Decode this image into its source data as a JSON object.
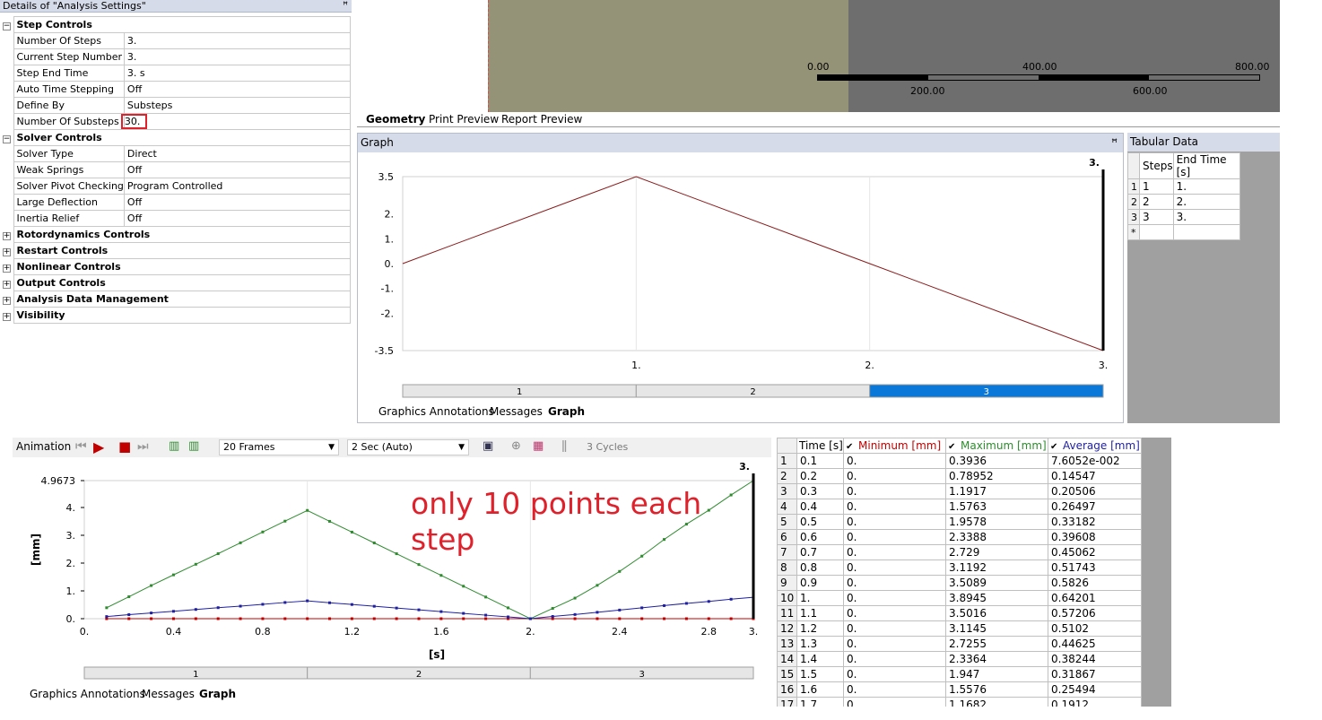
{
  "details": {
    "title": "Details of \"Analysis Settings\"",
    "pin": "ꟸ",
    "rows": [
      {
        "type": "group",
        "label": "Step Controls",
        "expander": "−"
      },
      {
        "type": "prop",
        "name": "Number Of Steps",
        "value": "3."
      },
      {
        "type": "prop",
        "name": "Current Step Number",
        "value": "3."
      },
      {
        "type": "prop",
        "name": "Step End Time",
        "value": "3. s"
      },
      {
        "type": "prop",
        "name": "Auto Time Stepping",
        "value": "Off"
      },
      {
        "type": "prop",
        "name": "Define By",
        "value": "Substeps"
      },
      {
        "type": "prop",
        "name": "Number Of Substeps",
        "value": "30.",
        "highlight": true
      },
      {
        "type": "group",
        "label": "Solver Controls",
        "expander": "−"
      },
      {
        "type": "prop",
        "name": "Solver Type",
        "value": "Direct"
      },
      {
        "type": "prop",
        "name": "Weak Springs",
        "value": "Off"
      },
      {
        "type": "prop",
        "name": "Solver Pivot Checking",
        "value": "Program Controlled"
      },
      {
        "type": "prop",
        "name": "Large Deflection",
        "value": "Off"
      },
      {
        "type": "prop",
        "name": "Inertia Relief",
        "value": "Off"
      },
      {
        "type": "group",
        "label": "Rotordynamics Controls",
        "expander": "+"
      },
      {
        "type": "group",
        "label": "Restart Controls",
        "expander": "+"
      },
      {
        "type": "group",
        "label": "Nonlinear Controls",
        "expander": "+"
      },
      {
        "type": "group",
        "label": "Output Controls",
        "expander": "+"
      },
      {
        "type": "group",
        "label": "Analysis Data Management",
        "expander": "+"
      },
      {
        "type": "group",
        "label": "Visibility",
        "expander": "+"
      }
    ]
  },
  "geometry": {
    "scale_top": [
      "0.00",
      "400.00",
      "800.00"
    ],
    "scale_bottom": [
      "200.00",
      "600.00"
    ],
    "tabs": [
      "Geometry",
      "Print Preview",
      "Report Preview"
    ]
  },
  "graph_panel": {
    "title": "Graph",
    "pin": "ꟸ",
    "tabs": [
      "Graphics Annotations",
      "Messages",
      "Graph"
    ]
  },
  "tabular": {
    "title": "Tabular Data",
    "headers": [
      "Steps",
      "End Time [s]"
    ],
    "rows": [
      [
        "1",
        "1",
        "1."
      ],
      [
        "2",
        "2",
        "2."
      ],
      [
        "3",
        "3",
        "3."
      ],
      [
        "*",
        "",
        ""
      ]
    ]
  },
  "animation": {
    "label": "Animation",
    "frames": "20 Frames",
    "duration": "2 Sec (Auto)",
    "cycles": "3 Cycles"
  },
  "annotation": "only 10 points each step",
  "bottom_tabs": [
    "Graphics Annotations",
    "Messages",
    "Graph"
  ],
  "data_table": {
    "headers": [
      "Time [s]",
      "Minimum [mm]",
      "Maximum [mm]",
      "Average [mm]"
    ],
    "header_colors": [
      "#000000",
      "#c00000",
      "#2e8b2e",
      "#1f1fa0"
    ],
    "rows": [
      [
        "1",
        "0.1",
        "0.",
        "0.3936",
        "7.6052e-002"
      ],
      [
        "2",
        "0.2",
        "0.",
        "0.78952",
        "0.14547"
      ],
      [
        "3",
        "0.3",
        "0.",
        "1.1917",
        "0.20506"
      ],
      [
        "4",
        "0.4",
        "0.",
        "1.5763",
        "0.26497"
      ],
      [
        "5",
        "0.5",
        "0.",
        "1.9578",
        "0.33182"
      ],
      [
        "6",
        "0.6",
        "0.",
        "2.3388",
        "0.39608"
      ],
      [
        "7",
        "0.7",
        "0.",
        "2.729",
        "0.45062"
      ],
      [
        "8",
        "0.8",
        "0.",
        "3.1192",
        "0.51743"
      ],
      [
        "9",
        "0.9",
        "0.",
        "3.5089",
        "0.5826"
      ],
      [
        "10",
        "1.",
        "0.",
        "3.8945",
        "0.64201"
      ],
      [
        "11",
        "1.1",
        "0.",
        "3.5016",
        "0.57206"
      ],
      [
        "12",
        "1.2",
        "0.",
        "3.1145",
        "0.5102"
      ],
      [
        "13",
        "1.3",
        "0.",
        "2.7255",
        "0.44625"
      ],
      [
        "14",
        "1.4",
        "0.",
        "2.3364",
        "0.38244"
      ],
      [
        "15",
        "1.5",
        "0.",
        "1.947",
        "0.31867"
      ],
      [
        "16",
        "1.6",
        "0.",
        "1.5576",
        "0.25494"
      ],
      [
        "17",
        "1.7",
        "0.",
        "1.1682",
        "0.1912"
      ]
    ]
  },
  "chart_data": [
    {
      "type": "line",
      "x": [
        0,
        1,
        2,
        3
      ],
      "series": [
        {
          "values": [
            0,
            3.5,
            0,
            -3.5
          ],
          "color": "#8b1a1a"
        }
      ],
      "yticks": [
        "3.5",
        "2.",
        "1.",
        "0.",
        "-1.",
        "-2.",
        "-3.5"
      ],
      "ytick_values": [
        3.5,
        2,
        1,
        0,
        -1,
        -2,
        -3.5
      ],
      "xticks": [
        "1.",
        "2.",
        "3."
      ],
      "xtick_values": [
        1,
        2,
        3
      ],
      "xlim": [
        0,
        3
      ],
      "ylim": [
        -3.5,
        3.5
      ],
      "marker_label": "3.",
      "steps": [
        "1",
        "2",
        "3"
      ],
      "active_step": 3
    },
    {
      "type": "line",
      "ylabel": "[mm]",
      "xlabel": "[s]",
      "x": [
        0.1,
        0.2,
        0.3,
        0.4,
        0.5,
        0.6,
        0.7,
        0.8,
        0.9,
        1.0,
        1.1,
        1.2,
        1.3,
        1.4,
        1.5,
        1.6,
        1.7,
        1.8,
        1.9,
        2.0,
        2.1,
        2.2,
        2.3,
        2.4,
        2.5,
        2.6,
        2.7,
        2.8,
        2.9,
        3.0
      ],
      "series": [
        {
          "name": "Minimum [mm]",
          "color": "#c00000",
          "values": [
            0,
            0,
            0,
            0,
            0,
            0,
            0,
            0,
            0,
            0,
            0,
            0,
            0,
            0,
            0,
            0,
            0,
            0,
            0,
            0,
            0,
            0,
            0,
            0,
            0,
            0,
            0,
            0,
            0,
            0
          ]
        },
        {
          "name": "Maximum [mm]",
          "color": "#2e8b2e",
          "values": [
            0.3936,
            0.78952,
            1.1917,
            1.5763,
            1.9578,
            2.3388,
            2.729,
            3.1192,
            3.5089,
            3.8945,
            3.5016,
            3.1145,
            2.7255,
            2.3364,
            1.947,
            1.5576,
            1.1682,
            0.7788,
            0.3894,
            0.0,
            0.37,
            0.74,
            1.2,
            1.7,
            2.25,
            2.85,
            3.4,
            3.9,
            4.45,
            4.9673
          ]
        },
        {
          "name": "Average [mm]",
          "color": "#1f1fa0",
          "values": [
            0.076052,
            0.14547,
            0.20506,
            0.26497,
            0.33182,
            0.39608,
            0.45062,
            0.51743,
            0.5826,
            0.64201,
            0.57206,
            0.5102,
            0.44625,
            0.38244,
            0.31867,
            0.25494,
            0.1912,
            0.127,
            0.064,
            0.0,
            0.08,
            0.15,
            0.23,
            0.31,
            0.39,
            0.47,
            0.55,
            0.62,
            0.7,
            0.77
          ]
        }
      ],
      "yticks": [
        "4.9673",
        "4.",
        "3.",
        "2.",
        "1.",
        "0."
      ],
      "ytick_values": [
        4.9673,
        4,
        3,
        2,
        1,
        0
      ],
      "xticks": [
        "0.",
        "0.4",
        "0.8",
        "1.2",
        "1.6",
        "2.",
        "2.4",
        "2.8",
        "3."
      ],
      "xtick_values": [
        0,
        0.4,
        0.8,
        1.2,
        1.6,
        2.0,
        2.4,
        2.8,
        3.0
      ],
      "xlim": [
        0,
        3
      ],
      "ylim": [
        0,
        4.9673
      ],
      "marker_label": "3.",
      "steps": [
        "1",
        "2",
        "3"
      ]
    }
  ]
}
